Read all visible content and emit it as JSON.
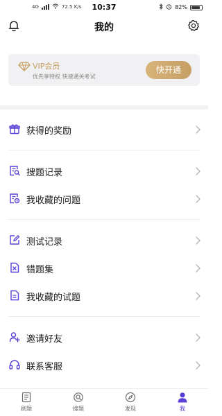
{
  "status_bar": {
    "network_left": "4G",
    "speed": "72.5 K/s",
    "time": "10:37",
    "battery": "82%"
  },
  "header": {
    "title": "我的"
  },
  "vip": {
    "title": "VIP会员",
    "subtitle": "优先享特权 快速通关考试",
    "button": "快开通",
    "accent_color": "#c59f64"
  },
  "menu": [
    {
      "label": "获得的奖励",
      "icon": "gift-icon"
    },
    {
      "label": "搜题记录",
      "icon": "search-record-icon"
    },
    {
      "label": "我收藏的问题",
      "icon": "collected-questions-icon"
    },
    {
      "label": "测试记录",
      "icon": "edit-icon"
    },
    {
      "label": "错题集",
      "icon": "wrong-questions-icon"
    },
    {
      "label": "我收藏的试题",
      "icon": "collected-tests-icon"
    },
    {
      "label": "邀请好友",
      "icon": "invite-friends-icon"
    },
    {
      "label": "联系客服",
      "icon": "headset-icon"
    }
  ],
  "tabs": [
    {
      "label": "刷题",
      "icon": "practice-icon"
    },
    {
      "label": "搜题",
      "icon": "search-tab-icon"
    },
    {
      "label": "发现",
      "icon": "compass-icon"
    },
    {
      "label": "我",
      "icon": "person-icon"
    }
  ],
  "accent_color": "#5b3fd6"
}
